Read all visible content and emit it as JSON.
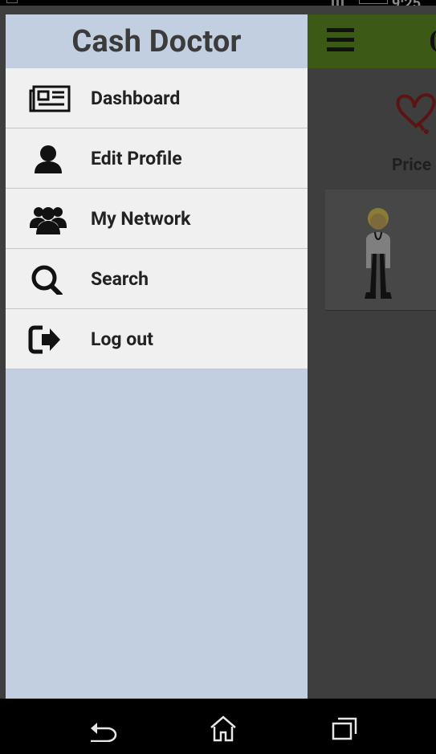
{
  "status_bar": {
    "time": "9:25"
  },
  "app_background": {
    "price_label": "Price"
  },
  "drawer": {
    "title": "Cash Doctor",
    "items": [
      {
        "label": "Dashboard",
        "icon": "newspaper-icon"
      },
      {
        "label": "Edit Profile",
        "icon": "user-icon"
      },
      {
        "label": "My Network",
        "icon": "users-icon"
      },
      {
        "label": "Search",
        "icon": "search-icon"
      },
      {
        "label": "Log out",
        "icon": "sign-out-icon"
      }
    ]
  },
  "nav_bar": {
    "buttons": [
      "back-icon",
      "home-icon",
      "recent-apps-icon"
    ]
  },
  "colors": {
    "drawer_bg": "#c1cfe0",
    "menu_item_bg": "#f0f0f0",
    "toolbar_green": "#3c5a16",
    "scrim": "#3e3e3e"
  }
}
